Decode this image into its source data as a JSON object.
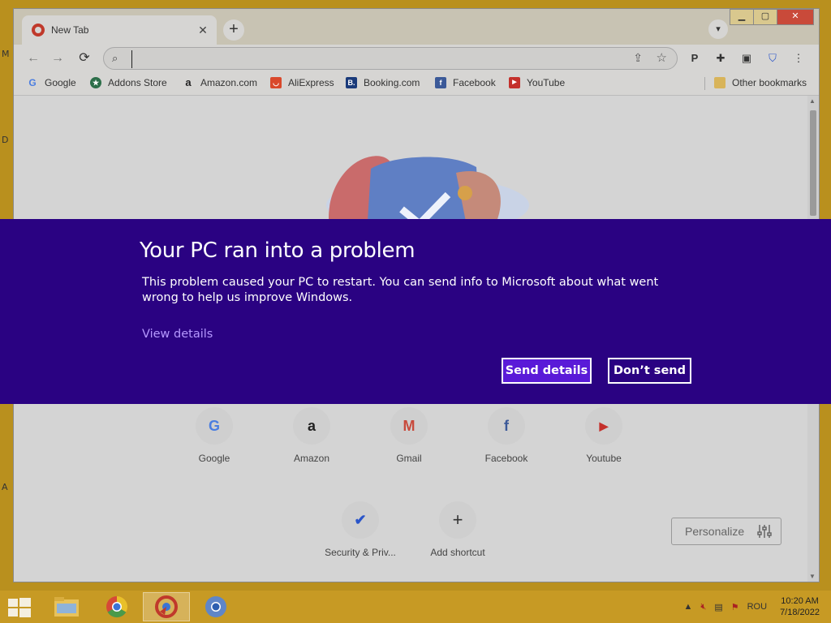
{
  "browser": {
    "tab": {
      "title": "New Tab"
    },
    "omnibox": {
      "placeholder": ""
    },
    "bookmarks": [
      {
        "label": "Google",
        "icon": "google-icon"
      },
      {
        "label": "Addons Store",
        "icon": "addons-store-icon"
      },
      {
        "label": "Amazon.com",
        "icon": "amazon-icon"
      },
      {
        "label": "AliExpress",
        "icon": "aliexpress-icon"
      },
      {
        "label": "Booking.com",
        "icon": "booking-icon"
      },
      {
        "label": "Facebook",
        "icon": "facebook-icon"
      },
      {
        "label": "YouTube",
        "icon": "youtube-icon"
      }
    ],
    "other_bookmarks": "Other bookmarks"
  },
  "newtab": {
    "shortcuts": [
      {
        "label": "Google",
        "glyph": "G"
      },
      {
        "label": "Amazon",
        "glyph": "a"
      },
      {
        "label": "Gmail",
        "glyph": "M"
      },
      {
        "label": "Facebook",
        "glyph": "f"
      },
      {
        "label": "Youtube",
        "glyph": "▶"
      },
      {
        "label": "Security & Priv...",
        "glyph": "✔"
      },
      {
        "label": "Add shortcut",
        "glyph": "+"
      }
    ],
    "personalize_label": "Personalize"
  },
  "crash": {
    "title": "Your PC ran into a problem",
    "body": "This problem caused your PC to restart. You can send info to Microsoft about what went wrong to help us improve Windows.",
    "link": "View details",
    "send_button": "Send details",
    "dont_send_button": "Don’t send",
    "background": "#2a0282"
  },
  "taskbar": {
    "language": "ROU",
    "time": "10:20 AM",
    "date": "7/18/2022"
  }
}
